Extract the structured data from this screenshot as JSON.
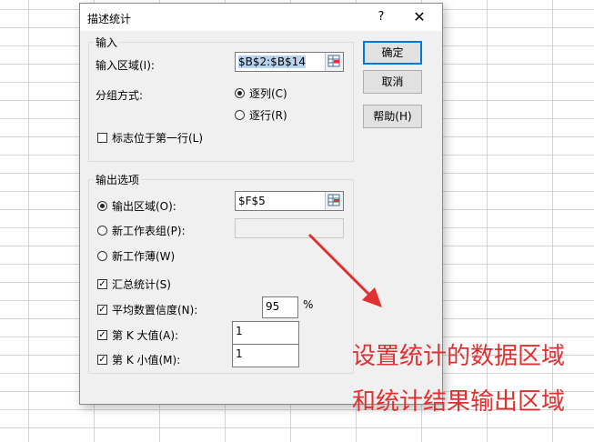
{
  "dialog": {
    "title": "描述统计",
    "help_glyph": "?",
    "close_glyph": "✕"
  },
  "input": {
    "group_label": "输入",
    "range_label": "输入区域(I):",
    "range_value": "$B$2:$B$14",
    "grouping_label": "分组方式:",
    "by_column": "逐列(C)",
    "by_row": "逐行(R)",
    "labels_first_row": "标志位于第一行(L)"
  },
  "output": {
    "group_label": "输出选项",
    "output_range_label": "输出区域(O):",
    "output_range_value": "$F$5",
    "new_sheet_label": "新工作表组(P):",
    "new_sheet_value": "",
    "new_workbook_label": "新工作薄(W)",
    "summary_stats": "汇总统计(S)",
    "confidence_label": "平均数置信度(N):",
    "confidence_value": "95",
    "confidence_unit": "%",
    "kth_largest_label": "第 K 大值(A):",
    "kth_largest_value": "1",
    "kth_smallest_label": "第 K 小值(M):",
    "kth_smallest_value": "1"
  },
  "buttons": {
    "ok": "确定",
    "cancel": "取消",
    "help": "帮助(H)"
  },
  "annotation": {
    "line1": "设置统计的数据区域",
    "line2": "和统计结果输出区域",
    "color": "#e03030"
  },
  "icons": {
    "range_picker": "range-select-icon",
    "check_mark": "✓"
  }
}
